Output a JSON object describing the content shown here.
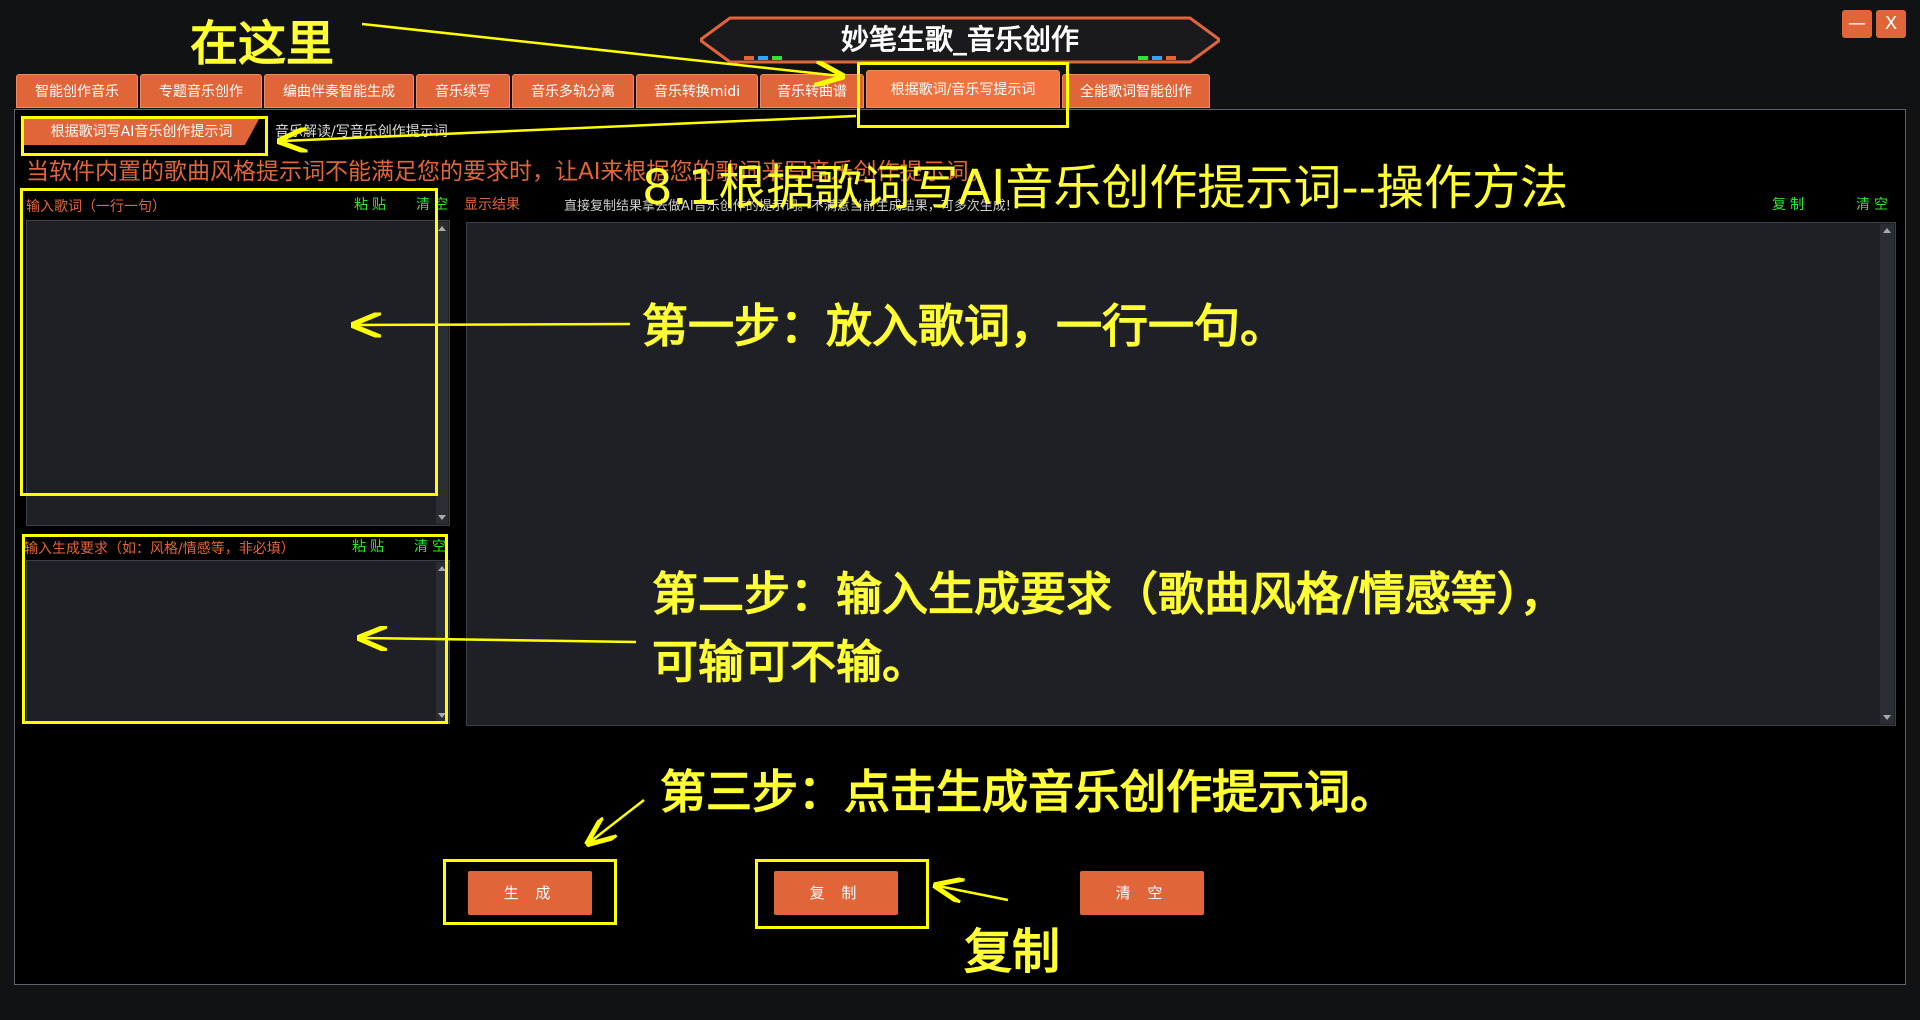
{
  "app": {
    "title": "妙笔生歌_音乐创作",
    "minimize_label": "—",
    "close_label": "X"
  },
  "tabs": [
    {
      "label": "智能创作音乐"
    },
    {
      "label": "专题音乐创作"
    },
    {
      "label": "编曲伴奏智能生成"
    },
    {
      "label": "音乐续写"
    },
    {
      "label": "音乐多轨分离"
    },
    {
      "label": "音乐转换midi"
    },
    {
      "label": "音乐转曲谱"
    },
    {
      "label": "根据歌词/音乐写提示词"
    },
    {
      "label": "全能歌词智能创作"
    }
  ],
  "subtabs": [
    {
      "label": "根据歌词写AI音乐创作提示词"
    },
    {
      "label": "音乐解读/写音乐创作提示词"
    }
  ],
  "info_text": "当软件内置的歌曲风格提示词不能满足您的要求时，让AI来根据您的歌词来写音乐创作提示词。",
  "lyrics_panel": {
    "label": "输入歌词（一行一句）",
    "paste": "粘贴",
    "clear": "清空"
  },
  "requirement_panel": {
    "label": "输入生成要求（如：风格/情感等，非必填）",
    "paste": "粘贴",
    "clear": "清空"
  },
  "result_panel": {
    "label": "显示结果",
    "hint": "直接复制结果拿去做AI音乐创作的提示词。不满意当前生成结果，可多次生成!",
    "copy": "复制",
    "clear": "清空"
  },
  "buttons": {
    "generate": "生 成",
    "copy": "复 制",
    "clear": "清 空"
  },
  "annotations": {
    "here": "在这里",
    "heading": "8.1根据歌词写AI音乐创作提示词--操作方法",
    "step1": "第一步：放入歌词，一行一句。",
    "step2_line1": "第二步：输入生成要求（歌曲风格/情感等），",
    "step2_line2": "可输可不输。",
    "step3": "第三步：点击生成音乐创作提示词。",
    "copy": "复制"
  },
  "colors": {
    "accent": "#e0663a",
    "annotation": "#ffff00",
    "link_green": "#2fe52f"
  }
}
